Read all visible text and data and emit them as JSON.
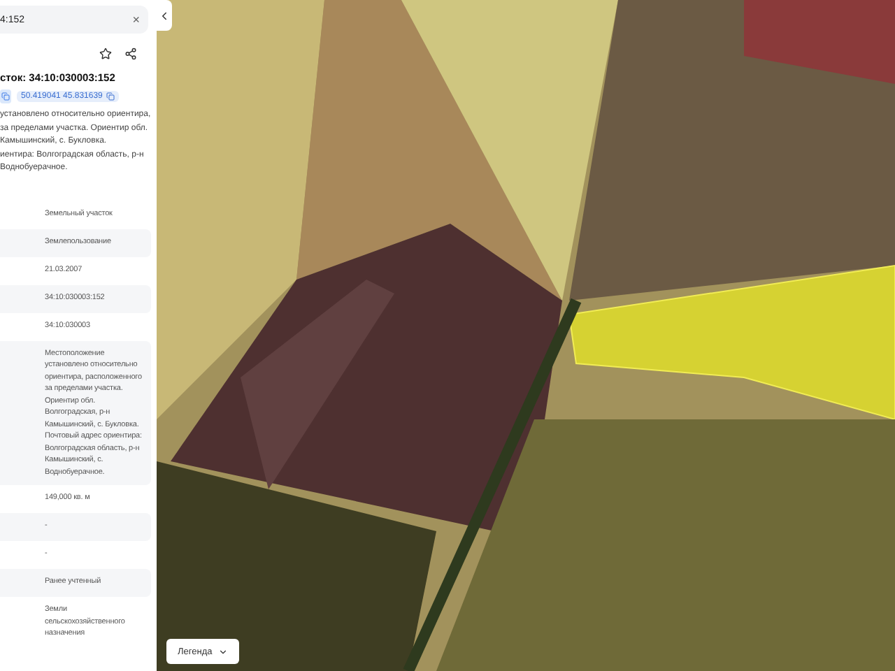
{
  "search": {
    "value": "4:152",
    "clear": "×"
  },
  "parcel": {
    "title": "сток: 34:10:030003:152",
    "coordinates": "50.419041 45.831639",
    "description": [
      "установлено относительно ориентира,",
      "за пределами участка. Ориентир обл.",
      "Камышинский, с. Букловка.",
      "иентира: Волгоградская область, р-н",
      "Воднобуерачное."
    ]
  },
  "rows": [
    {
      "value": "Земельный участок"
    },
    {
      "value": "Землепользование"
    },
    {
      "value": "21.03.2007"
    },
    {
      "value": "34:10:030003:152"
    },
    {
      "value": "34:10:030003"
    },
    {
      "value": "Местоположение установлено относительно ориентира, расположенного за пределами участка. Ориентир обл. Волгоградская, р-н Камышинский, с. Букловка. Почтовый адрес ориентира: Волгоградская область, р-н Камышинский, с. Воднобуерачное."
    },
    {
      "value": "149,000 кв. м"
    },
    {
      "value": "-"
    },
    {
      "value": "-"
    },
    {
      "value": "Ранее учтенный"
    },
    {
      "value": "Земли сельскохозяйственного назначения"
    }
  ],
  "map": {
    "legend_button": "Легенда"
  }
}
